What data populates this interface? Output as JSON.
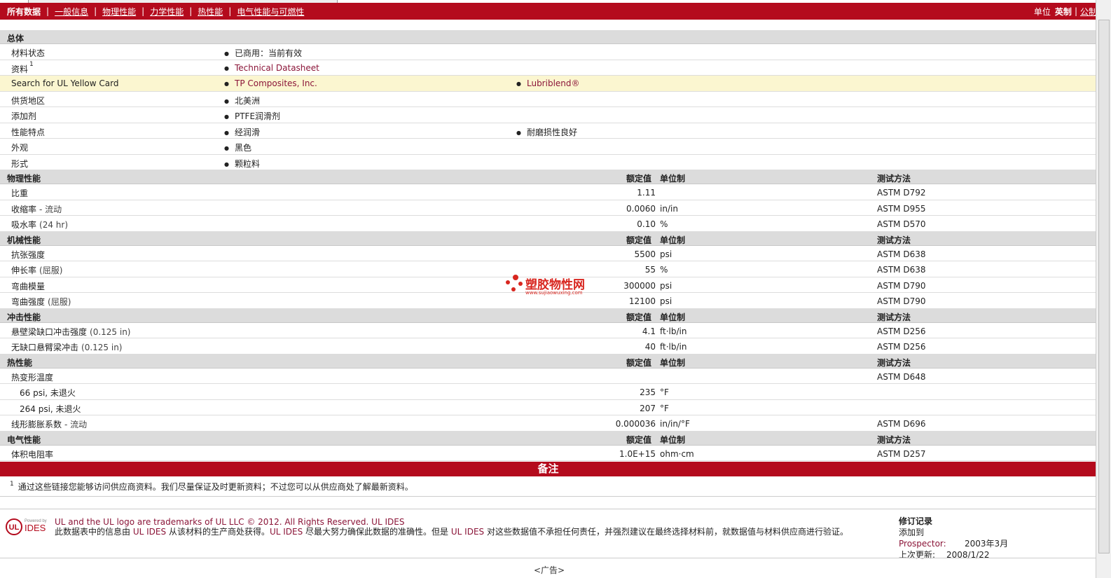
{
  "nav": {
    "items": [
      "所有数据",
      "一般信息",
      "物理性能",
      "力学性能",
      "热性能",
      "电气性能与可燃性"
    ],
    "unit_label": "单位",
    "unit_selected": "英制",
    "unit_sep": "|",
    "unit_other": "公制"
  },
  "general": {
    "title": "总体",
    "rows": [
      {
        "label": "材料状态",
        "b1": "已商用：当前有效"
      },
      {
        "label": "资料",
        "sup": "1",
        "b1": "Technical Datasheet"
      },
      {
        "label": "Search for UL Yellow Card",
        "b1": "TP Composites, Inc.",
        "b2": "Lubriblend®"
      },
      {
        "label": "供货地区",
        "b1": "北美洲"
      },
      {
        "label": "添加剂",
        "b1": "PTFE润滑剂"
      },
      {
        "label": "性能特点",
        "b1": "经润滑",
        "b2": "耐磨损性良好"
      },
      {
        "label": "外观",
        "b1": "黑色"
      },
      {
        "label": "形式",
        "b1": "颗粒料"
      }
    ]
  },
  "headers": {
    "value": "额定值",
    "unit": "单位制",
    "method": "测试方法"
  },
  "physical": {
    "title": "物理性能",
    "rows": [
      {
        "label": "比重",
        "cond": "",
        "value": "1.11",
        "unit": "",
        "method": "ASTM D792"
      },
      {
        "label": "收缩率",
        "cond": "- 流动",
        "value": "0.0060",
        "unit": "in/in",
        "method": "ASTM D955"
      },
      {
        "label": "吸水率",
        "cond": "(24 hr)",
        "value": "0.10",
        "unit": "%",
        "method": "ASTM D570"
      }
    ]
  },
  "mechanical": {
    "title": "机械性能",
    "rows": [
      {
        "label": "抗张强度",
        "cond": "",
        "value": "5500",
        "unit": "psi",
        "method": "ASTM D638"
      },
      {
        "label": "伸长率",
        "cond": "(屈服)",
        "value": "55",
        "unit": "%",
        "method": "ASTM D638"
      },
      {
        "label": "弯曲模量",
        "cond": "",
        "value": "300000",
        "unit": "psi",
        "method": "ASTM D790"
      },
      {
        "label": "弯曲强度",
        "cond": "(屈服)",
        "value": "12100",
        "unit": "psi",
        "method": "ASTM D790"
      }
    ]
  },
  "impact": {
    "title": "冲击性能",
    "rows": [
      {
        "label": "悬壁梁缺口冲击强度",
        "cond": "(0.125 in)",
        "value": "4.1",
        "unit": "ft·lb/in",
        "method": "ASTM D256"
      },
      {
        "label": "无缺口悬臂梁冲击",
        "cond": "(0.125 in)",
        "value": "40",
        "unit": "ft·lb/in",
        "method": "ASTM D256"
      }
    ]
  },
  "thermal": {
    "title": "热性能",
    "rows": [
      {
        "label": "热变形温度",
        "cond": "",
        "value": "",
        "unit": "",
        "method": "ASTM D648",
        "indent": false
      },
      {
        "label": "66 psi, 未退火",
        "cond": "",
        "value": "235",
        "unit": "°F",
        "method": "",
        "indent": true
      },
      {
        "label": "264 psi, 未退火",
        "cond": "",
        "value": "207",
        "unit": "°F",
        "method": "",
        "indent": true
      },
      {
        "label": "线形膨胀系数",
        "cond": "- 流动",
        "value": "0.000036",
        "unit": "in/in/°F",
        "method": "ASTM D696",
        "indent": false
      }
    ]
  },
  "electrical": {
    "title": "电气性能",
    "rows": [
      {
        "label": "体积电阻率",
        "cond": "",
        "value": "1.0E+15",
        "unit": "ohm·cm",
        "method": "ASTM D257"
      }
    ]
  },
  "notes": {
    "title": "备注",
    "num": "1",
    "text": "通过这些链接您能够访问供应商资料。我们尽量保证及时更新资料；不过您可以从供应商处了解最新资料。"
  },
  "footer": {
    "line1": "UL and the UL logo are trademarks of UL LLC © 2012. All Rights Reserved. UL IDES",
    "line2a": "此数据表中的信息由",
    "ul1": "UL IDES",
    "line2b": "从该材料的生产商处获得。",
    "ul2": "UL IDES",
    "line2c": "尽最大努力确保此数据的准确性。但是",
    "ul3": "UL IDES",
    "line2d": "对这些数据值不承担任何责任，并强烈建议在最终选择材料前，就数据值与材料供应商进行验证。",
    "logo_small": "Powered by",
    "logo_text": "IDES",
    "logo_ul": "UL"
  },
  "revision": {
    "title": "修订记录",
    "added_label": "添加到",
    "added_link": "Prospector:",
    "added_value": "2003年3月",
    "updated_label": "上次更新:",
    "updated_value": "2008/1/22"
  },
  "ad": "<广告>",
  "watermark": {
    "title": "塑胶物性网",
    "url": "www.sujiaowuxing.com"
  }
}
